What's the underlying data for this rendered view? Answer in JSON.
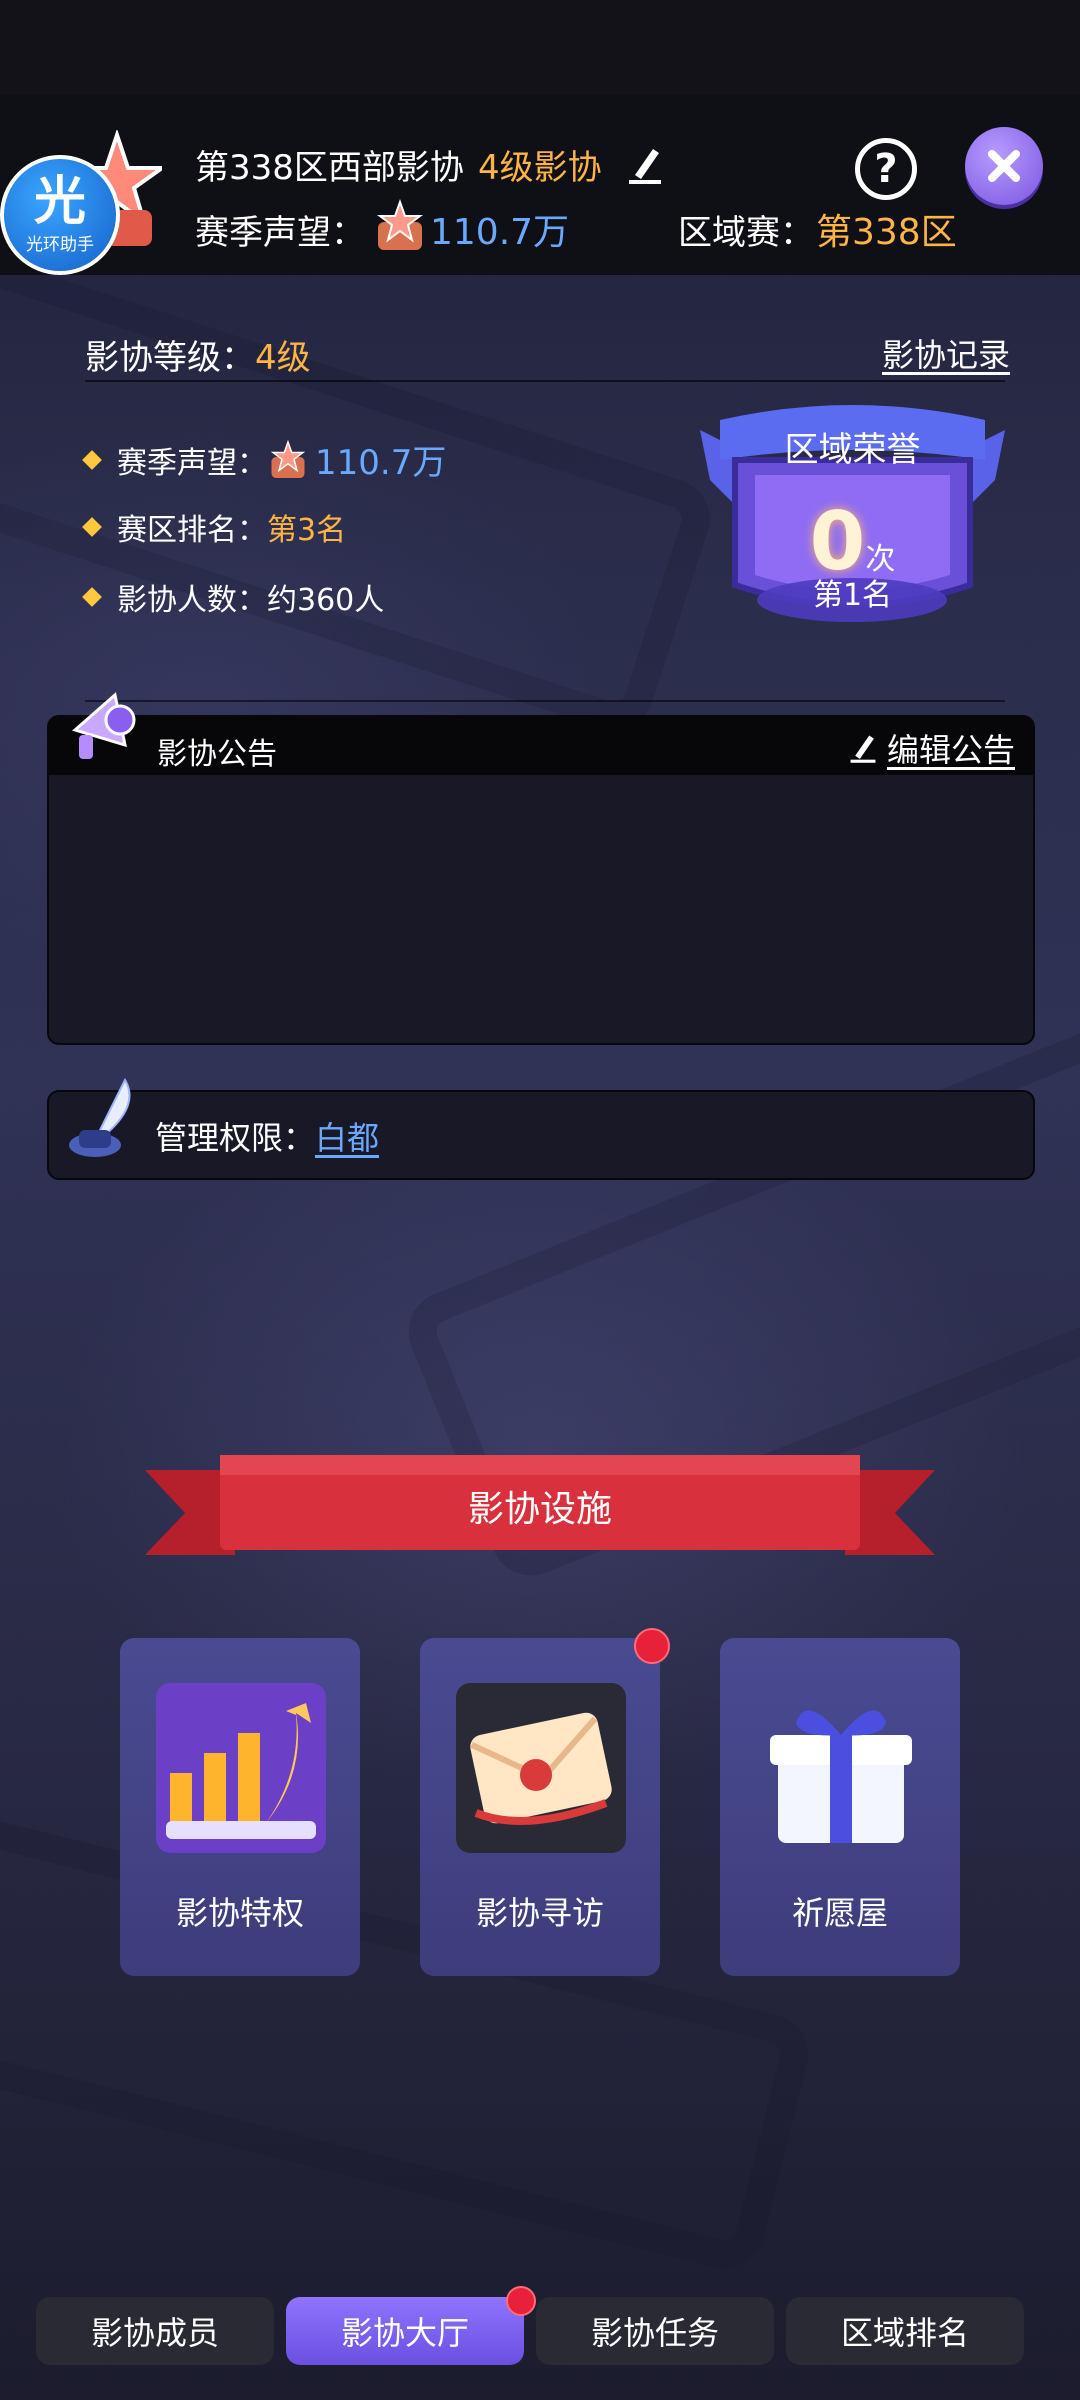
{
  "header": {
    "avatar_char": "光",
    "avatar_caption": "光环助手",
    "guild_name": "第338区西部影协",
    "guild_level": "4级影协",
    "reputation_label": "赛季声望：",
    "reputation_value": "110.7万",
    "region_label": "区域赛：",
    "region_value": "第338区"
  },
  "info": {
    "level_label": "影协等级：",
    "level_value": "4级",
    "records_link": "影协记录",
    "stats": {
      "reputation_label": "赛季声望：",
      "reputation_value": "110.7万",
      "rank_label": "赛区排名：",
      "rank_value": "第3名",
      "members_label": "影协人数：",
      "members_value": "约360人"
    }
  },
  "honor": {
    "title": "区域荣誉",
    "count": "0",
    "count_unit": "次",
    "rank": "第1名"
  },
  "notice": {
    "title": "影协公告",
    "edit_label": "编辑公告",
    "content": ""
  },
  "permission": {
    "label": "管理权限：",
    "name": "白都"
  },
  "facilities": {
    "banner": "影协设施",
    "items": [
      {
        "label": "影协特权"
      },
      {
        "label": "影协寻访"
      },
      {
        "label": "祈愿屋"
      }
    ]
  },
  "tabs": [
    {
      "label": "影协成员"
    },
    {
      "label": "影协大厅"
    },
    {
      "label": "影协任务"
    },
    {
      "label": "区域排名"
    }
  ],
  "colors": {
    "accent_orange": "#ffb445",
    "accent_blue": "#6aa9ff",
    "active_tab": "#7a5ff0",
    "notification_dot": "#e8203a"
  }
}
